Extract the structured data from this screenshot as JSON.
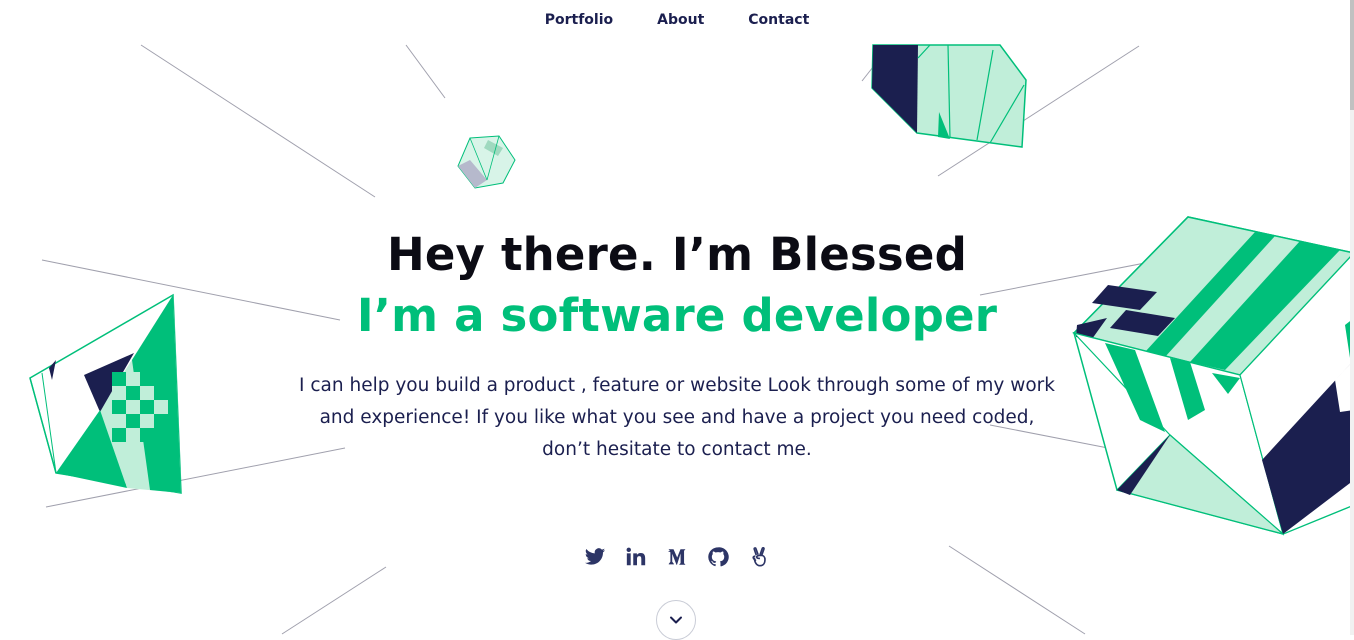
{
  "nav": {
    "items": [
      {
        "label": "Portfolio"
      },
      {
        "label": "About"
      },
      {
        "label": "Contact"
      }
    ]
  },
  "hero": {
    "headline": "Hey there. I’m Blessed",
    "subline": "I’m a software developer",
    "intro": "I can help you build a product , feature or website Look through some of my work and experience! If you like what you see and have a project you need coded, don’t hesitate to contact me."
  },
  "social": [
    {
      "icon": "twitter-icon"
    },
    {
      "icon": "linkedin-icon"
    },
    {
      "icon": "medium-icon"
    },
    {
      "icon": "github-icon"
    },
    {
      "icon": "angellist-icon"
    }
  ],
  "colors": {
    "accent": "#00bf7a",
    "navy": "#1b1f4f",
    "mint": "#c0eed9",
    "line": "#9a9aa8"
  }
}
